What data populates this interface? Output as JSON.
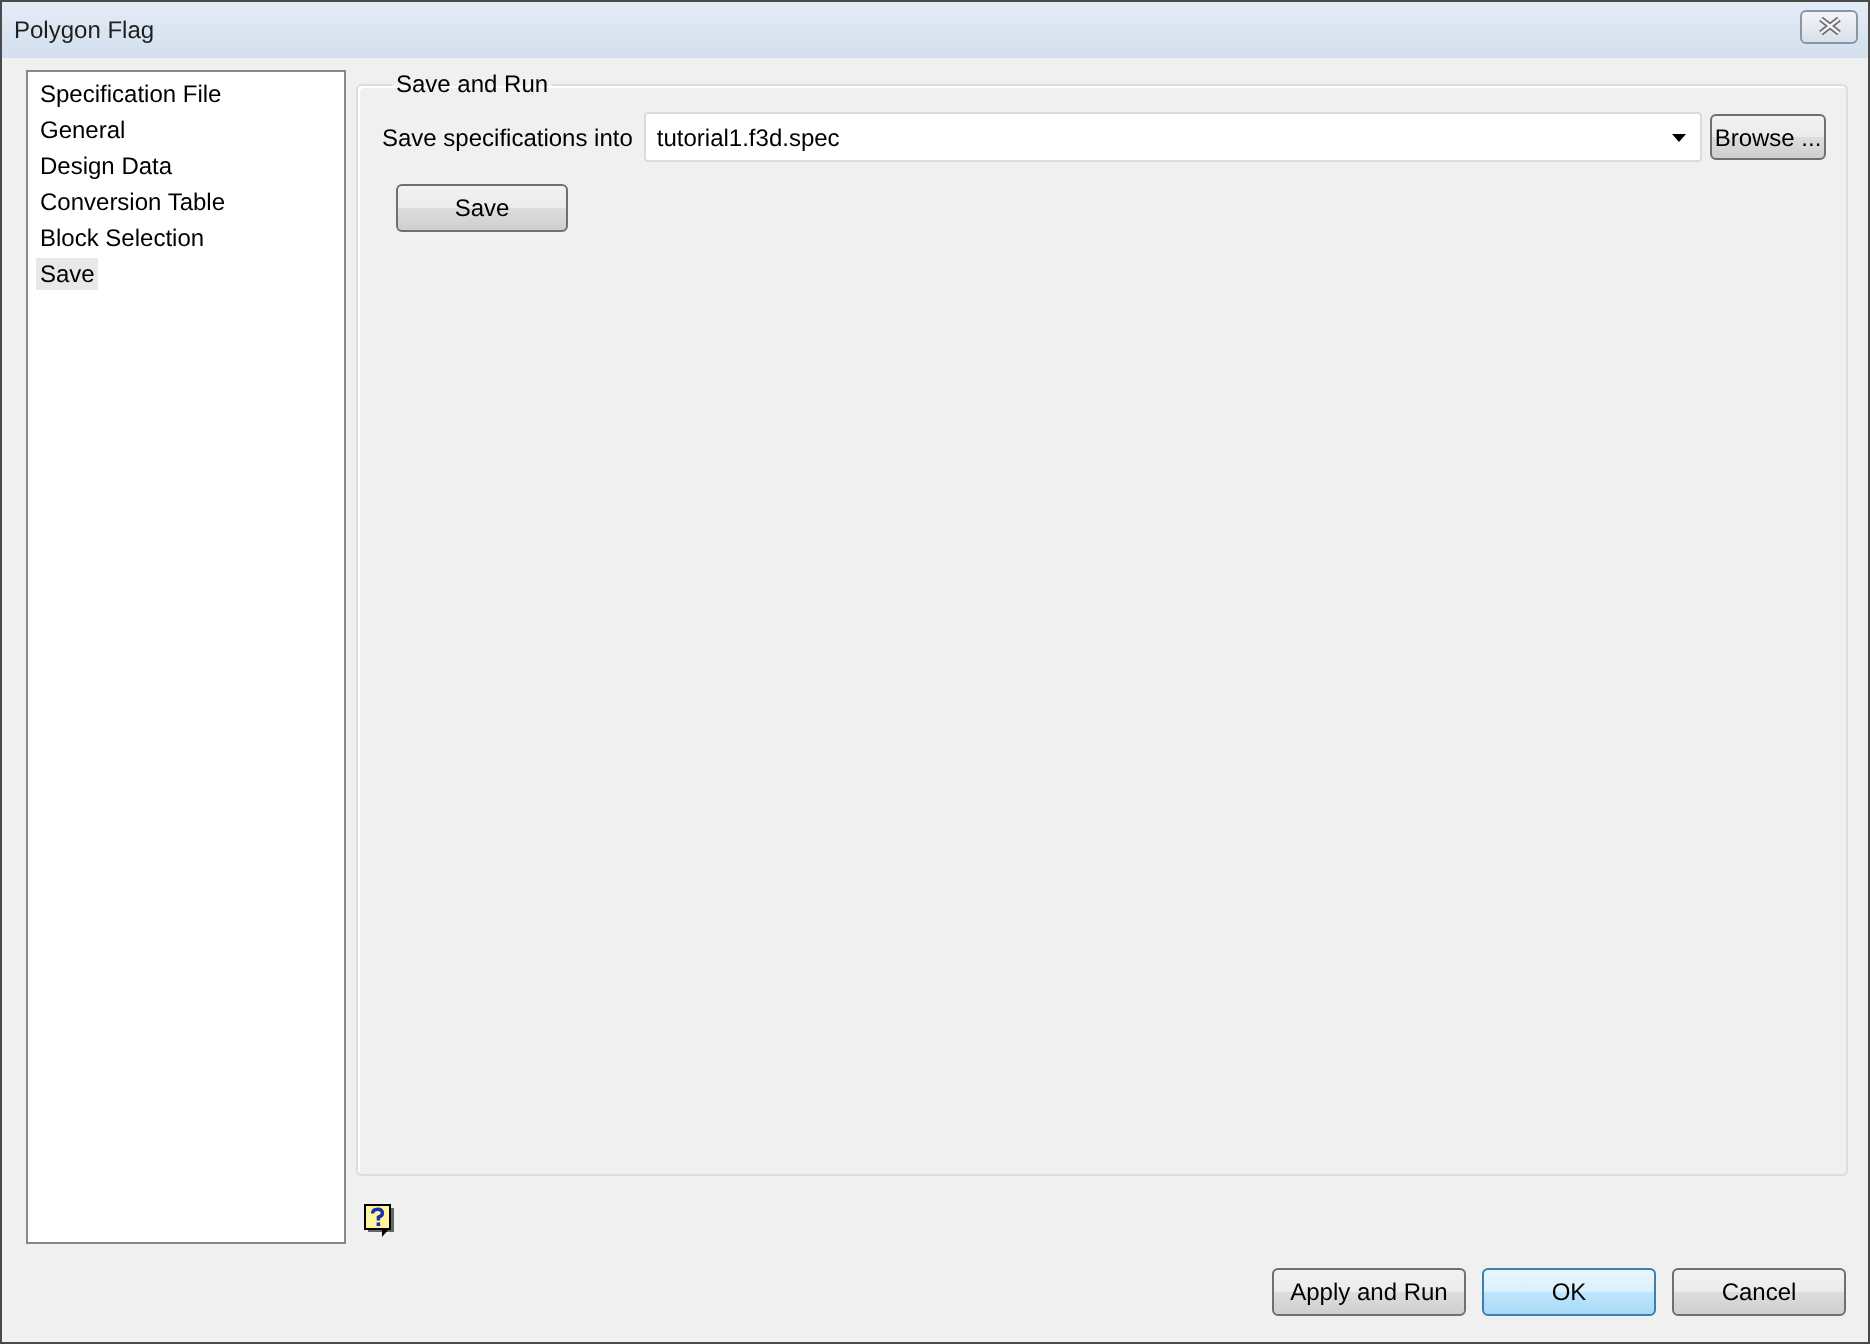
{
  "window": {
    "title": "Polygon Flag"
  },
  "sidebar": {
    "items": [
      {
        "label": "Specification File",
        "selected": false
      },
      {
        "label": "General",
        "selected": false
      },
      {
        "label": "Design Data",
        "selected": false
      },
      {
        "label": "Conversion Table",
        "selected": false
      },
      {
        "label": "Block Selection",
        "selected": false
      },
      {
        "label": "Save",
        "selected": true
      }
    ]
  },
  "group": {
    "title": "Save and Run",
    "field": {
      "label": "Save specifications into",
      "value": "tutorial1.f3d.spec"
    },
    "browse_button": "Browse ...",
    "save_button": "Save"
  },
  "buttons": [
    {
      "label": "Apply and Run",
      "default": false
    },
    {
      "label": "OK",
      "default": true
    },
    {
      "label": "Cancel",
      "default": false
    }
  ]
}
